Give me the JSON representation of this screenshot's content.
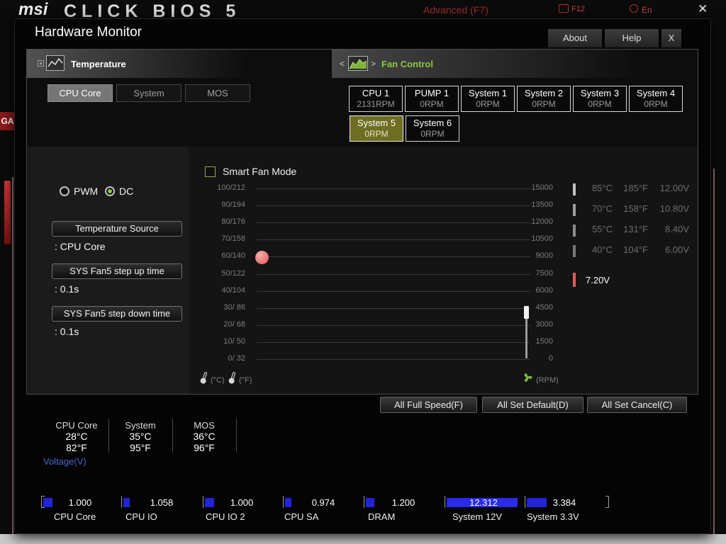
{
  "background": {
    "logo": "msi",
    "logo_text": "CLICK BIOS 5",
    "menu_advanced": "Advanced (F7)",
    "hotkey_label": "F12",
    "language_label": "En",
    "close_label": "✕",
    "game_boost_label": "GA"
  },
  "dialog": {
    "title": "Hardware Monitor",
    "about_label": "About",
    "help_label": "Help",
    "close_label": "X"
  },
  "monitor": {
    "temperature": {
      "title": "Temperature",
      "tabs": [
        {
          "label": "CPU Core",
          "active": true
        },
        {
          "label": "System",
          "active": false
        },
        {
          "label": "MOS",
          "active": false
        }
      ]
    },
    "fan_control": {
      "title": "Fan Control",
      "prev_arrow": "<",
      "next_arrow": ">",
      "fans": [
        {
          "name": "CPU 1",
          "rpm": "2131RPM",
          "active": false
        },
        {
          "name": "PUMP 1",
          "rpm": "0RPM",
          "active": false
        },
        {
          "name": "System 1",
          "rpm": "0RPM",
          "active": false
        },
        {
          "name": "System 2",
          "rpm": "0RPM",
          "active": false
        },
        {
          "name": "System 3",
          "rpm": "0RPM",
          "active": false
        },
        {
          "name": "System 4",
          "rpm": "0RPM",
          "active": false
        },
        {
          "name": "System 5",
          "rpm": "0RPM",
          "active": true
        },
        {
          "name": "System 6",
          "rpm": "0RPM",
          "active": false
        }
      ]
    },
    "settings": {
      "pwm_label": "PWM",
      "dc_label": "DC",
      "selected_mode": "DC",
      "fields": [
        {
          "label": "Temperature Source",
          "value": ": CPU Core"
        },
        {
          "label": "SYS Fan5 step up time",
          "value": ": 0.1s"
        },
        {
          "label": "SYS Fan5 step down time",
          "value": ": 0.1s"
        }
      ]
    },
    "chart": {
      "smart_fan_label": "Smart Fan Mode",
      "smart_fan_checked": false,
      "temp_axis": [
        "100/212",
        "90/194",
        "80/176",
        "70/158",
        "60/140",
        "50/122",
        "40/104",
        "30/ 86",
        "20/ 68",
        "10/ 50",
        "0/ 32"
      ],
      "rpm_axis": [
        "15000",
        "13500",
        "12000",
        "10500",
        "9000",
        "7500",
        "6000",
        "4500",
        "3000",
        "1500",
        "0"
      ],
      "unit_celsius": "(°C)",
      "unit_fahrenheit": "(°F)",
      "unit_rpm": "(RPM)"
    },
    "readouts": [
      {
        "temp_c": "85°C",
        "temp_f": "185°F",
        "voltage": "12.00V"
      },
      {
        "temp_c": "70°C",
        "temp_f": "158°F",
        "voltage": "10.80V"
      },
      {
        "temp_c": "55°C",
        "temp_f": "131°F",
        "voltage": "8.40V"
      },
      {
        "temp_c": "40°C",
        "temp_f": "104°F",
        "voltage": "6.00V"
      }
    ],
    "current_voltage": "7.20V"
  },
  "actions": {
    "full_speed_label": "All Full Speed(F)",
    "set_default_label": "All Set Default(D)",
    "set_cancel_label": "All Set Cancel(C)"
  },
  "status": {
    "temps": [
      {
        "name": "CPU Core",
        "celsius": "28°C",
        "fahrenheit": "82°F"
      },
      {
        "name": "System",
        "celsius": "35°C",
        "fahrenheit": "95°F"
      },
      {
        "name": "MOS",
        "celsius": "36°C",
        "fahrenheit": "96°F"
      }
    ],
    "voltage_title": "Voltage(V)",
    "voltages": [
      {
        "name": "CPU Core",
        "value": "1.000"
      },
      {
        "name": "CPU IO",
        "value": "1.058"
      },
      {
        "name": "CPU IO 2",
        "value": "1.000"
      },
      {
        "name": "CPU SA",
        "value": "0.974"
      },
      {
        "name": "DRAM",
        "value": "1.200"
      },
      {
        "name": "System 12V",
        "value": "12.312",
        "highlight": true
      },
      {
        "name": "System 3.3V",
        "value": "3.384"
      }
    ]
  },
  "colors": {
    "accent_green": "#8dc63f",
    "fan_active_bg": "#6e6e23",
    "handle_red": "#ee8181",
    "voltage_bar_blue": "#2323d8",
    "voltage_title_blue": "#4a66cc"
  }
}
